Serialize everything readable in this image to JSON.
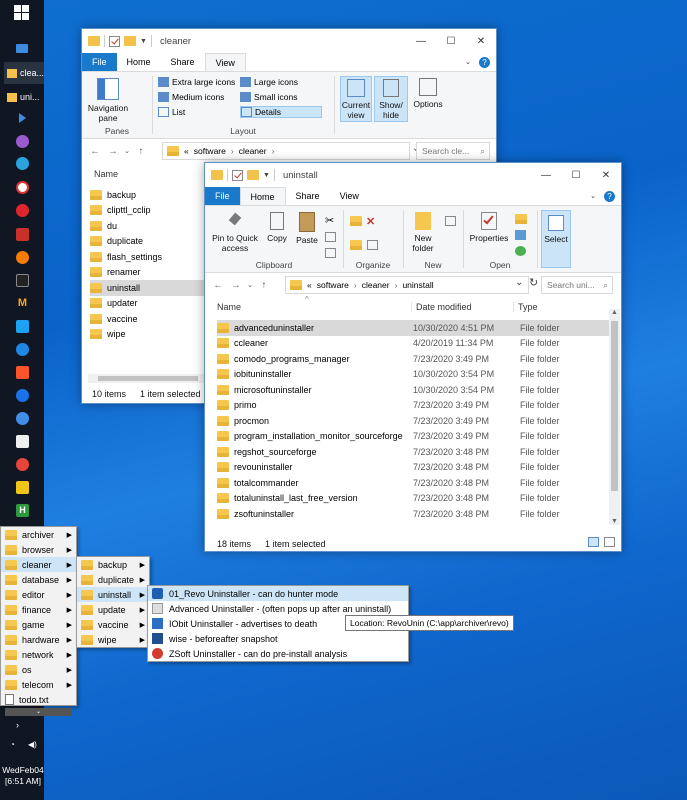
{
  "taskbar": {
    "apps": [
      {
        "label": "clea..."
      },
      {
        "label": "uni..."
      }
    ],
    "clock": {
      "day": "WedFeb04",
      "time": "[6:51 AM]"
    }
  },
  "cleaner_window": {
    "title": "cleaner",
    "tabs": [
      "File",
      "Home",
      "Share",
      "View"
    ],
    "ribbon": {
      "nav_pane": "Navigation pane",
      "layout_items": [
        "Extra large icons",
        "Large icons",
        "Medium icons",
        "Small icons",
        "List",
        "Details"
      ],
      "current_view": "Current view",
      "show_hide": "Show/ hide",
      "options": "Options",
      "groups": [
        "Panes",
        "Layout"
      ]
    },
    "address": {
      "prefix": "«",
      "crumbs": [
        "software",
        "cleaner"
      ]
    },
    "search_placeholder": "Search cle...",
    "column": "Name",
    "items": [
      "backup",
      "clipttl_cclip",
      "du",
      "duplicate",
      "flash_settings",
      "renamer",
      "uninstall",
      "updater",
      "vaccine",
      "wipe"
    ],
    "selected": "uninstall",
    "status": {
      "count": "10 items",
      "selected": "1 item selected"
    }
  },
  "uninstall_window": {
    "title": "uninstall",
    "tabs": [
      "File",
      "Home",
      "Share",
      "View"
    ],
    "ribbon": {
      "pin": "Pin to Quick access",
      "copy": "Copy",
      "paste": "Paste",
      "new_folder": "New folder",
      "properties": "Properties",
      "select": "Select",
      "groups": [
        "Clipboard",
        "Organize",
        "New",
        "Open"
      ]
    },
    "address": {
      "prefix": "«",
      "crumbs": [
        "software",
        "cleaner",
        "uninstall"
      ]
    },
    "search_placeholder": "Search uni...",
    "columns": [
      "Name",
      "Date modified",
      "Type"
    ],
    "rows": [
      {
        "name": "advanceduninstaller",
        "date": "10/30/2020 4:51 PM",
        "type": "File folder"
      },
      {
        "name": "ccleaner",
        "date": "4/20/2019 11:34 PM",
        "type": "File folder"
      },
      {
        "name": "comodo_programs_manager",
        "date": "7/23/2020 3:49 PM",
        "type": "File folder"
      },
      {
        "name": "iobituninstaller",
        "date": "10/30/2020 3:54 PM",
        "type": "File folder"
      },
      {
        "name": "microsoftuninstaller",
        "date": "10/30/2020 3:54 PM",
        "type": "File folder"
      },
      {
        "name": "primo",
        "date": "7/23/2020 3:49 PM",
        "type": "File folder"
      },
      {
        "name": "procmon",
        "date": "7/23/2020 3:49 PM",
        "type": "File folder"
      },
      {
        "name": "program_installation_monitor_sourceforge",
        "date": "7/23/2020 3:49 PM",
        "type": "File folder"
      },
      {
        "name": "regshot_sourceforge",
        "date": "7/23/2020 3:48 PM",
        "type": "File folder"
      },
      {
        "name": "revouninstaller",
        "date": "7/23/2020 3:48 PM",
        "type": "File folder"
      },
      {
        "name": "totalcommander",
        "date": "7/23/2020 3:48 PM",
        "type": "File folder"
      },
      {
        "name": "totaluninstall_last_free_version",
        "date": "7/23/2020 3:48 PM",
        "type": "File folder"
      },
      {
        "name": "zsoftuninstaller",
        "date": "7/23/2020 3:48 PM",
        "type": "File folder"
      }
    ],
    "selected": "advanceduninstaller",
    "status": {
      "count": "18 items",
      "selected": "1 item selected"
    }
  },
  "menu1": [
    "archiver",
    "browser",
    "cleaner",
    "database",
    "editor",
    "finance",
    "game",
    "hardware",
    "network",
    "os",
    "telecom",
    "todo.txt"
  ],
  "menu2": [
    "backup",
    "duplicate",
    "uninstall",
    "update",
    "vaccine",
    "wipe"
  ],
  "menu3": [
    "01_Revo Uninstaller - can do hunter mode",
    "Advanced Uninstaller - (often pops up after an uninstall)",
    "IObit Uninstaller - advertises to death",
    "wise - beforeafter snapshot",
    "ZSoft Uninstaller - can do pre-install analysis"
  ],
  "tooltip": "Location: RevoUnin (C:\\app\\archiver\\revo)"
}
